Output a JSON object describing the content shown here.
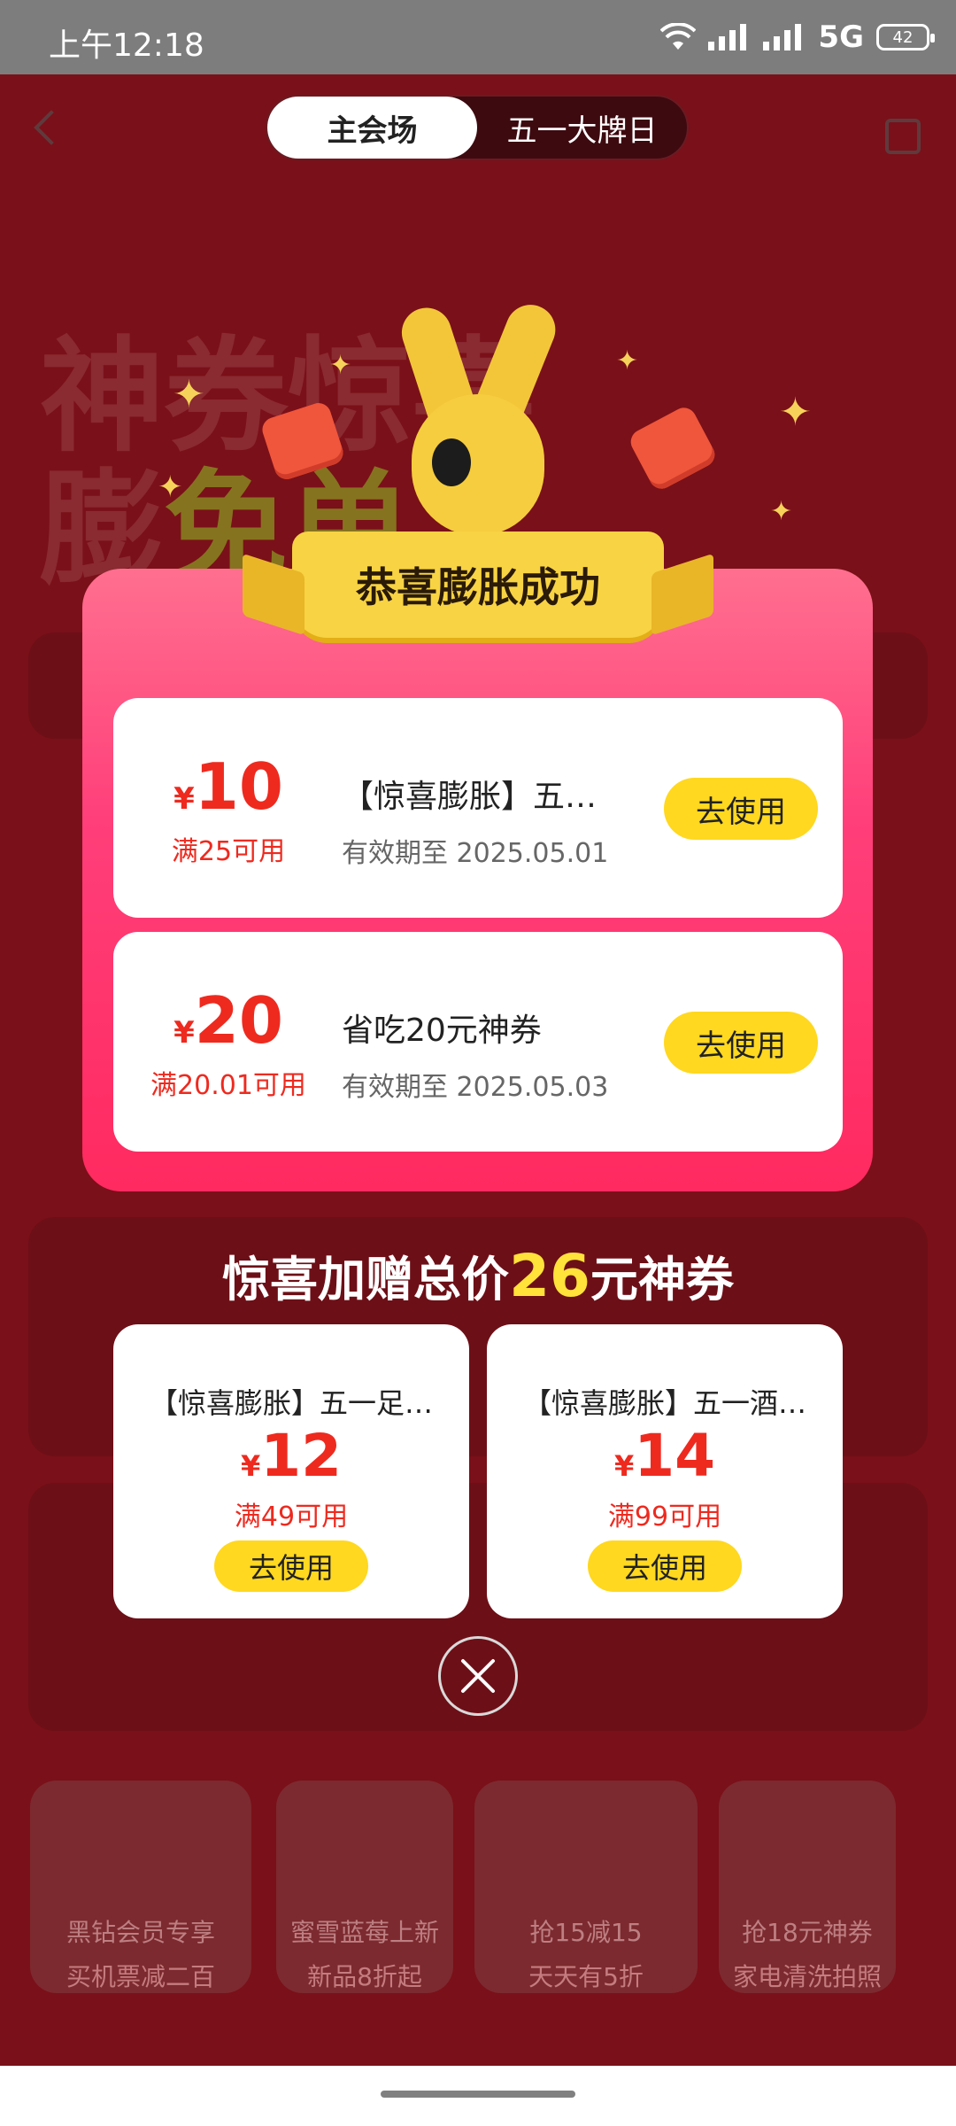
{
  "status_bar": {
    "time": "上午12:18",
    "network": "5G",
    "battery": "42"
  },
  "header": {
    "tabs": [
      {
        "label": "主会场",
        "active": true
      },
      {
        "label": "五一大牌日",
        "active": false
      }
    ]
  },
  "background": {
    "banner_line1": "神券惊喜",
    "banner_line2a": "膨",
    "banner_line2b": "免单",
    "tiles": [
      {
        "tag": "黑钻会员专享",
        "sub": "买机票减二百"
      },
      {
        "tag": "蜜雪蓝莓上新",
        "sub": "新品8折起"
      },
      {
        "tag": "抢15减15",
        "sub": "天天有5折"
      },
      {
        "tag": "抢18元神券",
        "sub": "家电清洗拍照"
      }
    ]
  },
  "popup": {
    "ribbon_title": "恭喜膨胀成功",
    "coupons": [
      {
        "currency": "¥",
        "amount": "10",
        "condition": "满25可用",
        "name": "【惊喜膨胀】五…",
        "expiry": "有效期至 2025.05.01",
        "button": "去使用"
      },
      {
        "currency": "¥",
        "amount": "20",
        "condition": "满20.01可用",
        "name": "省吃20元神券",
        "expiry": "有效期至 2025.05.03",
        "button": "去使用"
      }
    ],
    "bonus_title_prefix": "惊喜加赠总价",
    "bonus_title_amount": "26",
    "bonus_title_suffix": "元神券",
    "bonus_coupons": [
      {
        "name": "【惊喜膨胀】五一足…",
        "currency": "¥",
        "amount": "12",
        "condition": "满49可用",
        "button": "去使用"
      },
      {
        "name": "【惊喜膨胀】五一酒…",
        "currency": "¥",
        "amount": "14",
        "condition": "满99可用",
        "button": "去使用"
      }
    ]
  },
  "colors": {
    "accent_red": "#ee2a1f",
    "button_yellow": "#ffd81f",
    "modal_pink": "#ff3f7a"
  }
}
